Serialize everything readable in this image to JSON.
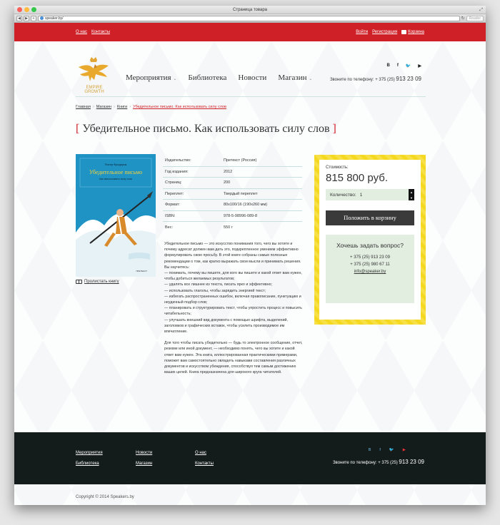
{
  "browser": {
    "window_title": "Страница товара",
    "address": "speaker.by/",
    "reader_label": "Reader",
    "nav_back": "◀",
    "nav_forward": "▶",
    "nav_add": "+"
  },
  "topbar": {
    "left_links": [
      "О нас",
      "Контакты"
    ],
    "login": "Войти",
    "register": "Регистрация",
    "cart": "Корзина"
  },
  "header": {
    "logo_line1": "EMPIRE",
    "logo_line2": "GROWTH",
    "nav": [
      "Мероприятия",
      "Библиотека",
      "Новости",
      "Магазин"
    ],
    "nav_caret": "⌄",
    "socials": [
      "B",
      "f",
      "🐦",
      "▶"
    ],
    "phone_label": "Звоните по телефону:",
    "phone_code": "+ 375 (25)",
    "phone_number": "913 23 09"
  },
  "breadcrumb": {
    "items": [
      "Главная",
      "Магазин",
      "Книги"
    ],
    "current": "Убедительное письмо. Как использовать силу слов",
    "sep": "›"
  },
  "product": {
    "title": "Убедительное письмо. Как использовать силу слов",
    "cover_author": "Питер Фредерик",
    "cover_title": "Убедительное письмо",
    "cover_subtitle": "Как использовать силу слов",
    "cover_publisher": "ПРЕТЕКСТ",
    "read_link": "Пролистать книгу",
    "specs": [
      {
        "k": "Издательство:",
        "v": "Претекст (Россия)"
      },
      {
        "k": "Год издания:",
        "v": "2012"
      },
      {
        "k": "Страниц:",
        "v": "200"
      },
      {
        "k": "Переплет:",
        "v": "Твердый переплет"
      },
      {
        "k": "Формат:",
        "v": "80x100/16  (190x260 мм)"
      },
      {
        "k": "ISBN:",
        "v": "978-5-98996-089-8"
      },
      {
        "k": "Вес:",
        "v": "550 г"
      }
    ],
    "desc_p1": "Убедительное письмо — это искусство понимания того, чего вы хотите и почему адресат должен вам дать это, подкрепленное умением эффективно формулировать свою просьбу. В этой книге собраны самые полезные рекомендации о том, как кратко выражать свои мысли и принимать решения. Вы научитесь:",
    "desc_list": [
      "— понимать, почему вы пишете, для кого вы пишете и какой ответ вам нужен, чтобы добиться желаемых результатов;",
      "— удалять все лишнее из текста, писать ярко и эффективно;",
      "— использовать глаголы, чтобы зарядить энергией текст;",
      "— избегать распространенных ошибок, включая правописание, пунктуацию и неудачный подбор слов;",
      "— планировать и структурировать текст, чтобы упростить процесс и повысить читабельность;",
      "— улучшать внешний вид документа с помощью шрифта, выделений, заголовков и графических вставок, чтобы усилить производимое им впечатление."
    ],
    "desc_p2": "Для того чтобы писать убедительно — будь то электронное сообщение, отчет, резюме или иной документ, — необходимо понять, чего вы хотите и какой ответ вам нужен. Эта книга, иллюстрированная практическими примерами, поможет вам самостоятельно овладеть навыками составления различных документов и искусством убеждения, способствуя тем самым достижению ваших целей. Книга предназначена для широкого круга читателей."
  },
  "buy": {
    "price_label": "Стоимость:",
    "price": "815 800 руб.",
    "qty_label": "Количество:",
    "qty_value": "1",
    "up": "▲",
    "down": "▼",
    "cart_button": "Положить в корзину",
    "ask_title": "Хочешь задать вопрос?",
    "phone1": "+ 375 (25) 913 23 09",
    "phone2": "+ 375 (25) 980 67 11",
    "email": "info@speaker.by"
  },
  "footer": {
    "col1": [
      "Мероприятия",
      "Библиотека"
    ],
    "col2": [
      "Новости",
      "Магазин"
    ],
    "col3": [
      "О нас",
      "Контакты"
    ],
    "socials": [
      "B",
      "f",
      "🐦",
      "▶"
    ],
    "phone_label": "Звоните по телефону:",
    "phone_code": "+ 375 (25)",
    "phone_number": "913 23 09",
    "copyright": "Copyright © 2014 Speakers.by"
  },
  "colors": {
    "brand_red": "#cf2028",
    "price_yellow": "#f5d820",
    "footer_dark": "#141b1b",
    "soft_green": "#e2efe0"
  }
}
